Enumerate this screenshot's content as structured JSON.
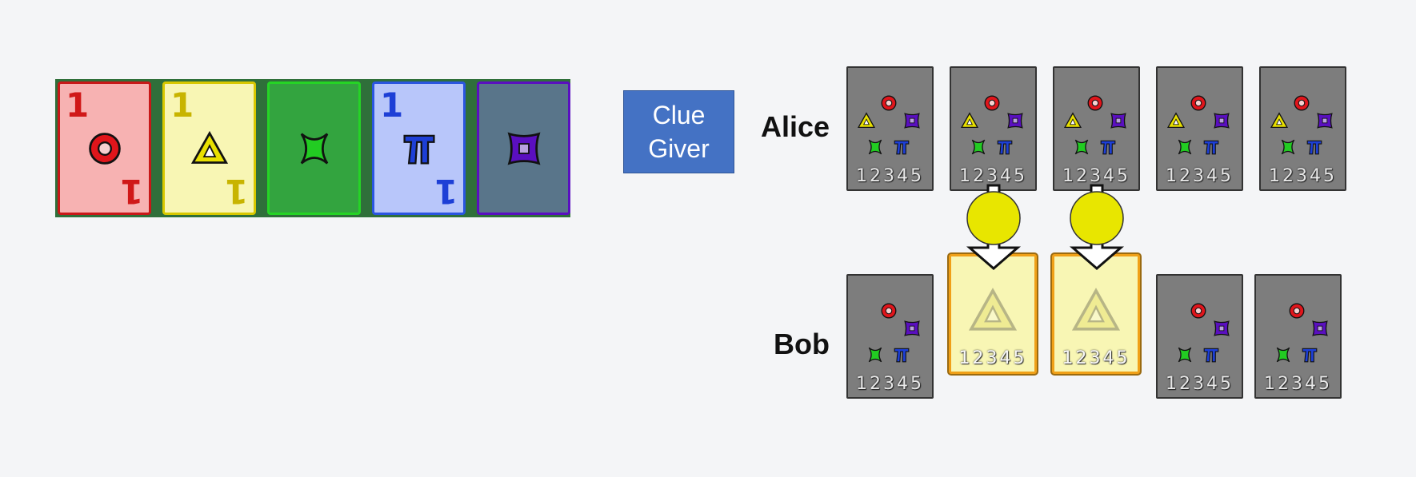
{
  "colors": {
    "background": "#f4f5f7",
    "stack_bg": "#2f6f3a",
    "red": "#e0151b",
    "yellow": "#e8e000",
    "green": "#22cc22",
    "blue": "#1d3fd6",
    "purple": "#5a0fc0",
    "clue_giver": "#4472c4",
    "clue_circle": "#e8e600",
    "card_back": "#7d7d7d"
  },
  "play_stacks": [
    {
      "suit": "red",
      "suit_icon": "circle-icon",
      "rank": "1",
      "face": "#f7b2b2",
      "border": "#c81818",
      "rank_color": "#d01818"
    },
    {
      "suit": "yellow",
      "suit_icon": "triangle-icon",
      "rank": "1",
      "face": "#f8f6b4",
      "border": "#d8c800",
      "rank_color": "#c8b400"
    },
    {
      "suit": "green",
      "suit_icon": "cross-icon",
      "rank": "",
      "face": "#33a43f",
      "border": "#25d425",
      "rank_color": "#22aa22"
    },
    {
      "suit": "blue",
      "suit_icon": "pi-icon",
      "rank": "1",
      "face": "#b8c6fa",
      "border": "#2a55e0",
      "rank_color": "#1d3fd6"
    },
    {
      "suit": "purple",
      "suit_icon": "square-icon",
      "rank": "",
      "face": "#59758a",
      "border": "#5a0fc0",
      "rank_color": "#5a0fc0"
    }
  ],
  "clue_giver": {
    "line1": "Clue",
    "line2": "Giver"
  },
  "players": [
    {
      "name": "Alice",
      "cards": [
        {
          "type": "unknown",
          "ranks": "1 2 3 4 5"
        },
        {
          "type": "unknown",
          "ranks": "1 2 3 4 5"
        },
        {
          "type": "unknown",
          "ranks": "1 2 3 4 5"
        },
        {
          "type": "unknown",
          "ranks": "1 2 3 4 5"
        },
        {
          "type": "unknown",
          "ranks": "1 2 3 4 5"
        }
      ]
    },
    {
      "name": "Bob",
      "cards": [
        {
          "type": "no-yellow",
          "ranks": "1 2 3 4 5"
        },
        {
          "type": "yellow-clued",
          "ranks": "1 2 3 4 5"
        },
        {
          "type": "yellow-clued",
          "ranks": "1 2 3 4 5"
        },
        {
          "type": "no-yellow",
          "ranks": "1 2 3 4 5"
        },
        {
          "type": "no-yellow",
          "ranks": "1 2 3 4 5"
        }
      ]
    }
  ],
  "clue": {
    "color": "yellow",
    "targets": [
      2,
      3
    ]
  }
}
